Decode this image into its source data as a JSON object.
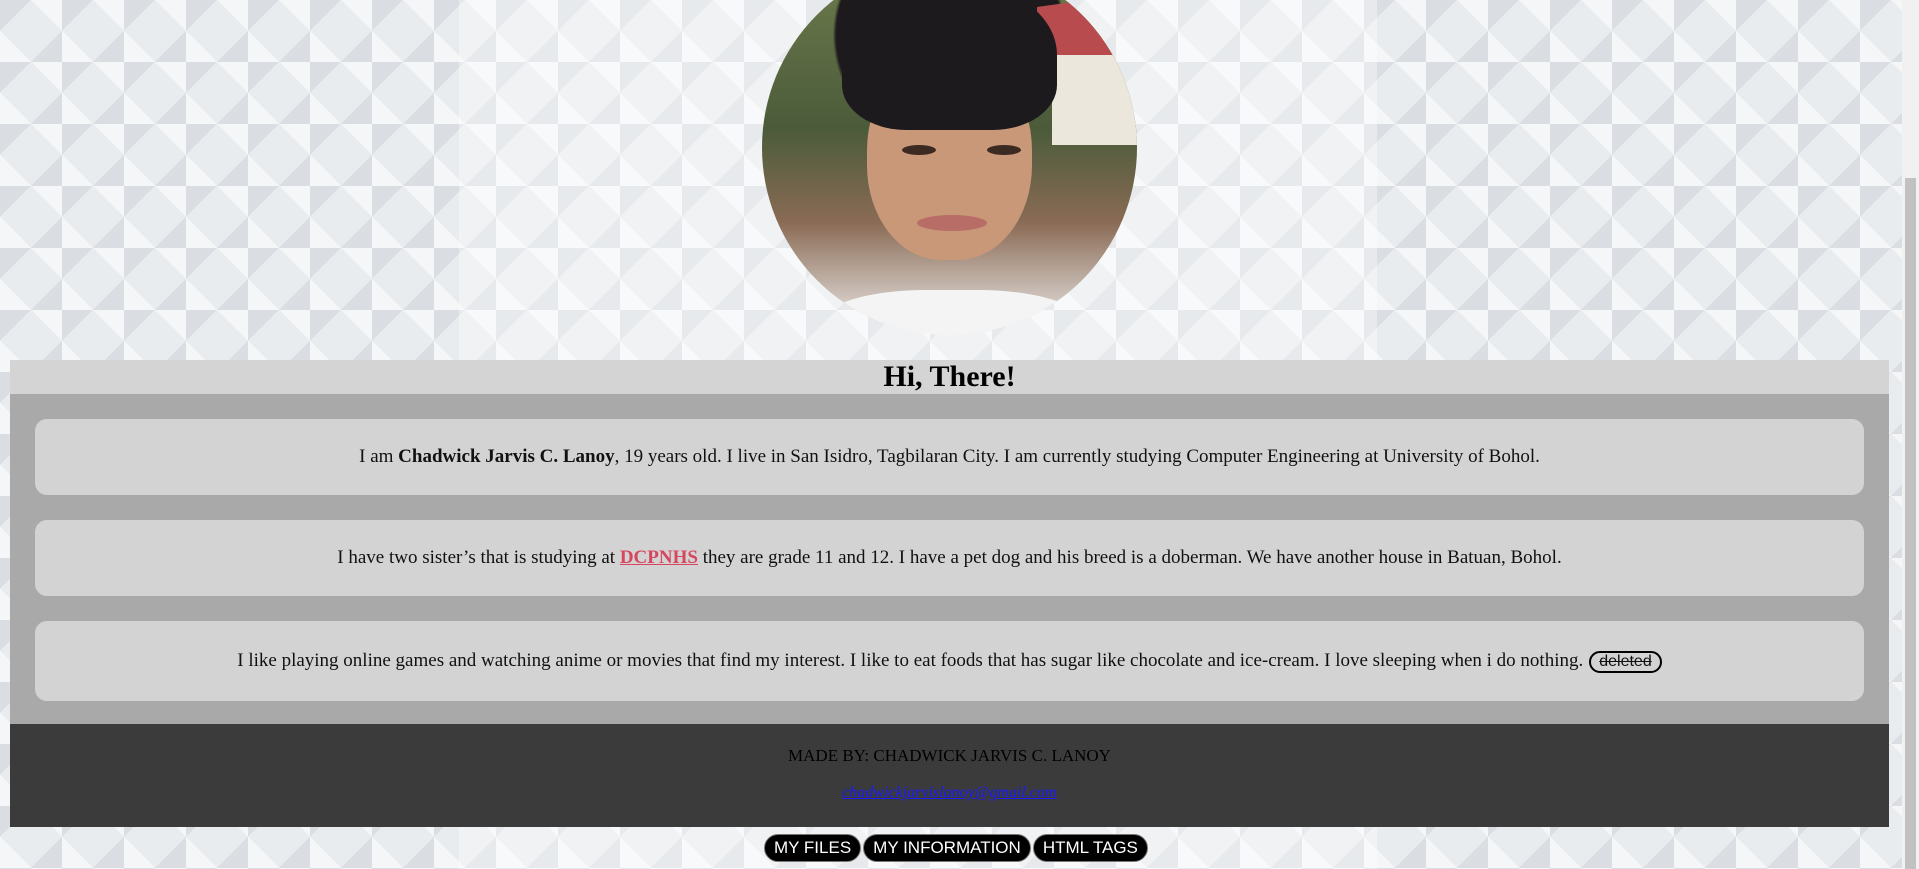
{
  "header": {
    "title": "Hi, There!"
  },
  "about": {
    "p1_prefix": "I am ",
    "p1_name": "Chadwick Jarvis C. Lanoy",
    "p1_suffix": ", 19 years old. I live in San Isidro, Tagbilaran City. I am currently studying Computer Engineering at University of Bohol.",
    "p2_prefix": "I have two sister’s that is studying at ",
    "p2_link": "DCPNHS",
    "p2_suffix": " they are grade 11 and 12. I have a pet dog and his breed is a doberman. We have another house in Batuan, Bohol.",
    "p3_text": "I like playing online games and watching anime or movies that find my interest. I like to eat foods that has sugar like chocolate and ice-cream. I love sleeping when i do nothing.",
    "p3_deleted": "deleted"
  },
  "footer": {
    "made_by": "MADE BY: CHADWICK JARVIS C. LANOY",
    "email": "chadwickjarvislanoy@gmail.com"
  },
  "nav": {
    "files": "MY FILES",
    "information": "MY INFORMATION",
    "html_tags": "HTML TAGS"
  },
  "colors": {
    "link_accent": "#d6475f",
    "card_header": "#d4d4d4",
    "card_body": "#a9a9a9",
    "footer_bg": "#3b3b3b"
  }
}
